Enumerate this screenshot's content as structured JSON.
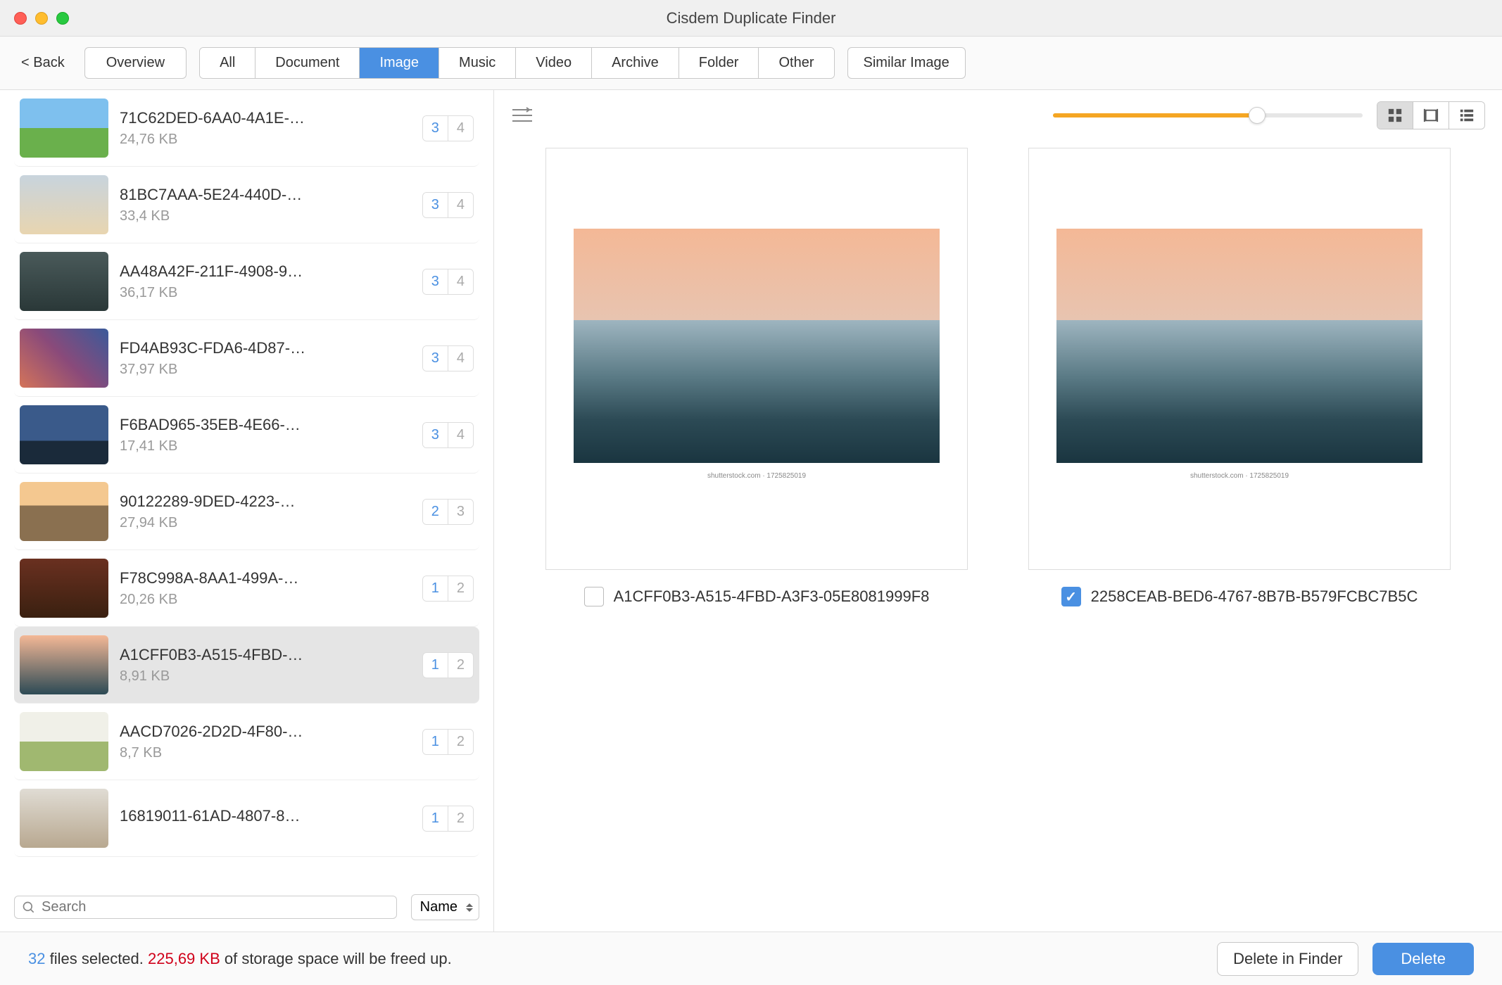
{
  "window": {
    "title": "Cisdem Duplicate Finder"
  },
  "nav": {
    "back": "< Back",
    "overview": "Overview",
    "tabs": [
      "All",
      "Document",
      "Image",
      "Music",
      "Video",
      "Archive",
      "Folder",
      "Other"
    ],
    "active_tab": "Image",
    "similar": "Similar Image"
  },
  "list": {
    "items": [
      {
        "name": "71C62DED-6AA0-4A1E-…",
        "size": "24,76 KB",
        "sel": "3",
        "tot": "4",
        "thumb": "th-field"
      },
      {
        "name": "81BC7AAA-5E24-440D-…",
        "size": "33,4 KB",
        "sel": "3",
        "tot": "4",
        "thumb": "th-person"
      },
      {
        "name": "AA48A42F-211F-4908-9…",
        "size": "36,17 KB",
        "sel": "3",
        "tot": "4",
        "thumb": "th-lake"
      },
      {
        "name": "FD4AB93C-FDA6-4D87-…",
        "size": "37,97 KB",
        "sel": "3",
        "tot": "4",
        "thumb": "th-nebula"
      },
      {
        "name": "F6BAD965-35EB-4E66-…",
        "size": "17,41 KB",
        "sel": "3",
        "tot": "4",
        "thumb": "th-tree"
      },
      {
        "name": "90122289-9DED-4223-…",
        "size": "27,94 KB",
        "sel": "2",
        "tot": "3",
        "thumb": "th-temple"
      },
      {
        "name": "F78C998A-8AA1-499A-…",
        "size": "20,26 KB",
        "sel": "1",
        "tot": "2",
        "thumb": "th-fox"
      },
      {
        "name": "A1CFF0B3-A515-4FBD-…",
        "size": "8,91 KB",
        "sel": "1",
        "tot": "2",
        "thumb": "th-mtns",
        "selected": true
      },
      {
        "name": "AACD7026-2D2D-4F80-…",
        "size": "8,7 KB",
        "sel": "1",
        "tot": "2",
        "thumb": "th-grass"
      },
      {
        "name": "16819011-61AD-4807-8…",
        "size": "",
        "sel": "1",
        "tot": "2",
        "thumb": "th-woman"
      }
    ],
    "search_placeholder": "Search",
    "sort": "Name"
  },
  "preview": {
    "watermark": "shutterstock.com · 1725825019",
    "items": [
      {
        "filename": "A1CFF0B3-A515-4FBD-A3F3-05E8081999F8",
        "checked": false
      },
      {
        "filename": "2258CEAB-BED6-4767-8B7B-B579FCBC7B5C",
        "checked": true
      }
    ],
    "slider_percent": 66
  },
  "footer": {
    "count": "32",
    "count_suffix": " files selected. ",
    "size": "225,69 KB",
    "size_suffix": " of storage space will be freed up.",
    "finder": "Delete in Finder",
    "delete": "Delete"
  }
}
